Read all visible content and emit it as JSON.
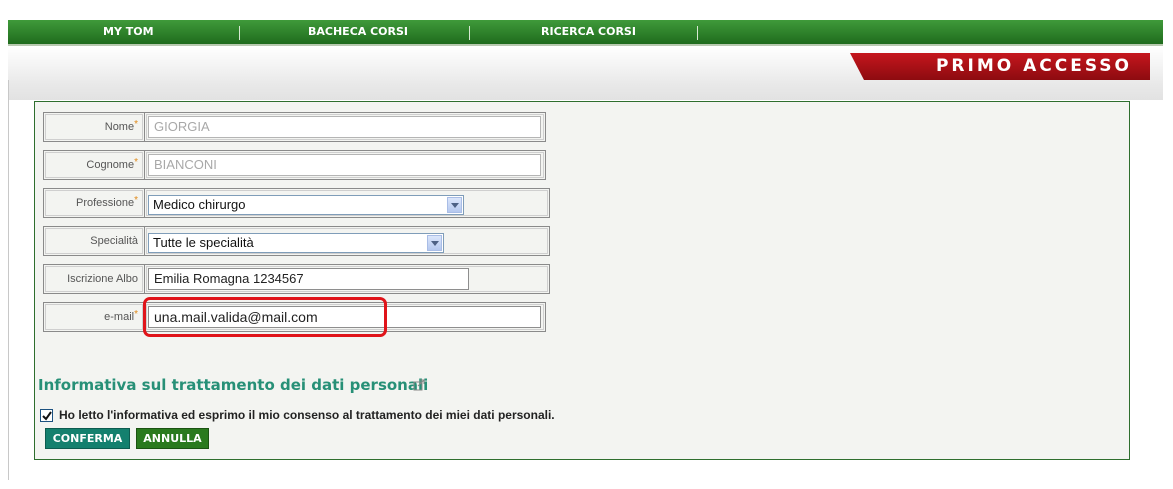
{
  "nav": {
    "items": [
      "MY TOM",
      "BACHECA CORSI",
      "RICERCA CORSI"
    ]
  },
  "header": {
    "banner": "PRIMO ACCESSO"
  },
  "form": {
    "nome": {
      "label": "Nome",
      "required": "*",
      "value": "GIORGIA"
    },
    "cognome": {
      "label": "Cognome",
      "required": "*",
      "value": "BIANCONI"
    },
    "professione": {
      "label": "Professione",
      "required": "*",
      "selected": "Medico chirurgo"
    },
    "specialita": {
      "label": "Specialità",
      "selected": "Tutte le specialità"
    },
    "albo": {
      "label": "Iscrizione Albo",
      "value": "Emilia Romagna 1234567"
    },
    "email": {
      "label": "e-mail",
      "required": "*",
      "value": "una.mail.valida@mail.com"
    }
  },
  "privacy": {
    "title": "Informativa sul trattamento dei dati personali",
    "consent": "Ho letto l'informativa ed esprimo il mio consenso al trattamento dei miei dati personali.",
    "checked": true
  },
  "buttons": {
    "confirm": "CONFERMA",
    "cancel": "ANNULLA"
  },
  "colors": {
    "nav_green": "#2a7f27",
    "banner_red": "#b3121a",
    "title_teal": "#279077",
    "highlight_red": "#e0141a"
  }
}
